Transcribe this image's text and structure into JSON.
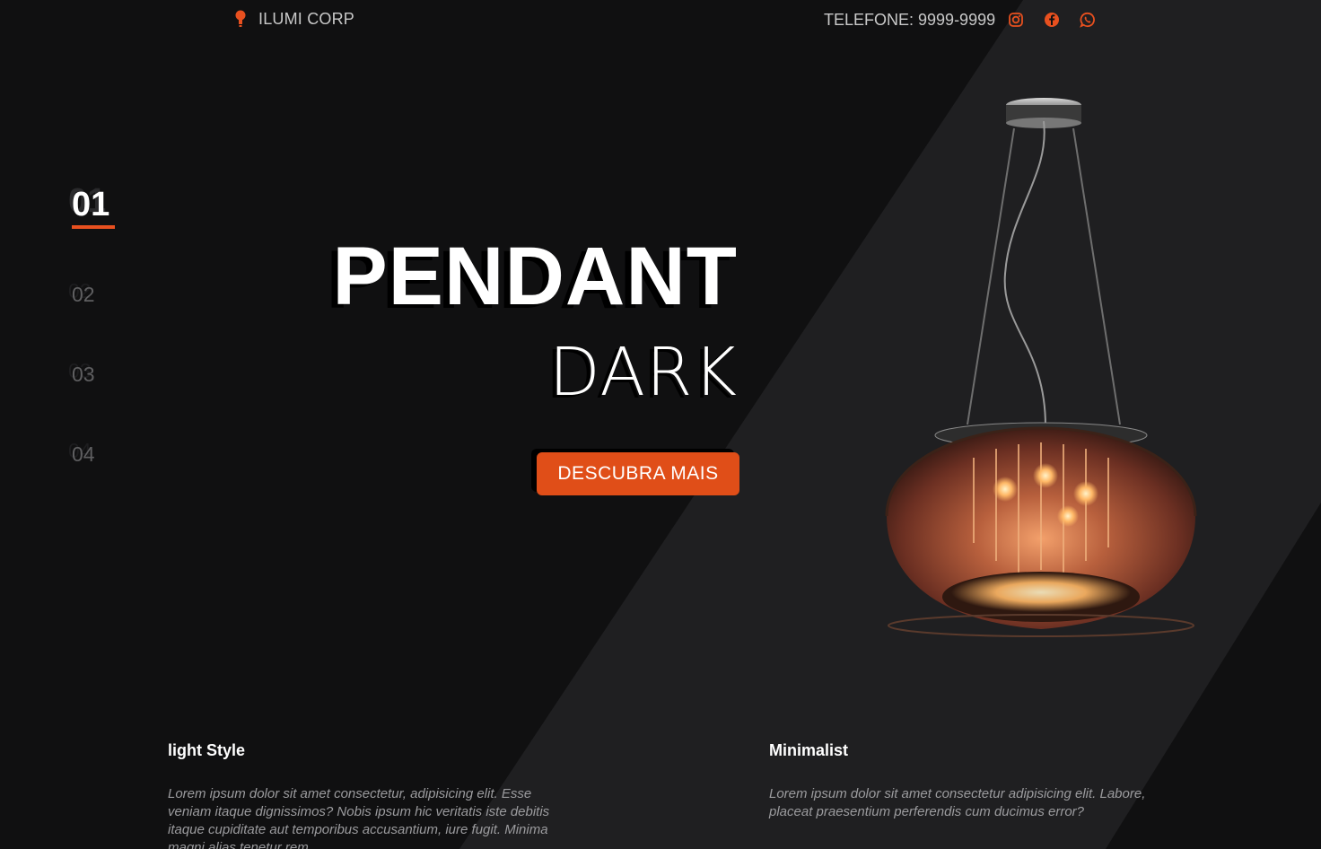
{
  "header": {
    "brand_name": "ILUMI CORP",
    "brand_icon": "lightbulb-icon",
    "phone_text": "TELEFONE: 9999-9999",
    "social": [
      {
        "name": "instagram-icon"
      },
      {
        "name": "facebook-icon"
      },
      {
        "name": "whatsapp-icon"
      }
    ]
  },
  "slides": {
    "items": [
      "01",
      "02",
      "03",
      "04"
    ],
    "active": "01"
  },
  "hero": {
    "title": "PENDANT",
    "subtitle": "DARK",
    "cta_label": "DESCUBRA MAIS"
  },
  "features": [
    {
      "title": "light Style",
      "text": "Lorem ipsum dolor sit amet consectetur, adipisicing elit. Esse veniam itaque dignissimos? Nobis ipsum hic veritatis iste debitis itaque cupiditate aut temporibus accusantium, iure fugit. Minima magni alias tenetur rem."
    },
    {
      "title": "Minimalist",
      "text": "Lorem ipsum dolor sit amet consectetur adipisicing elit. Labore, placeat praesentium perferendis cum ducimus error?"
    }
  ],
  "colors": {
    "background": "#101011",
    "accent": "#e04e18",
    "stripe": "#1f1f21"
  }
}
